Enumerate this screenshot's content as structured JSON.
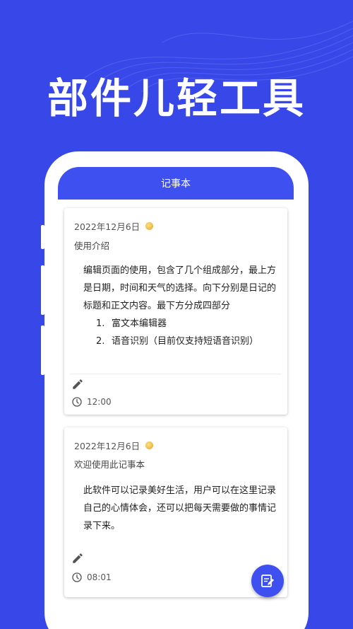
{
  "promo": {
    "headline": "部件儿轻工具"
  },
  "app": {
    "title": "记事本"
  },
  "notes": [
    {
      "date": "2022年12月6日",
      "weather_icon": "sunny-icon",
      "title": "使用介绍",
      "body": "编辑页面的使用，包含了几个组成部分，最上方是日期，时间和天气的选择。向下分别是日记的标题和正文内容。最下方分成四部分",
      "list": [
        {
          "num": "1.",
          "text": "富文本编辑器"
        },
        {
          "num": "2.",
          "text": "语音识别（目前仅支持短语音识别）"
        }
      ],
      "time": "12:00"
    },
    {
      "date": "2022年12月6日",
      "weather_icon": "sunny-icon",
      "title": "欢迎使用此记事本",
      "body": "此软件可以记录美好生活，用户可以在这里记录自己的心情体会，还可以把每天需要做的事情记录下来。",
      "time": "08:01"
    }
  ],
  "colors": {
    "background": "#3848e8",
    "appbar": "#3e50f0",
    "fab": "#3e50f0"
  }
}
